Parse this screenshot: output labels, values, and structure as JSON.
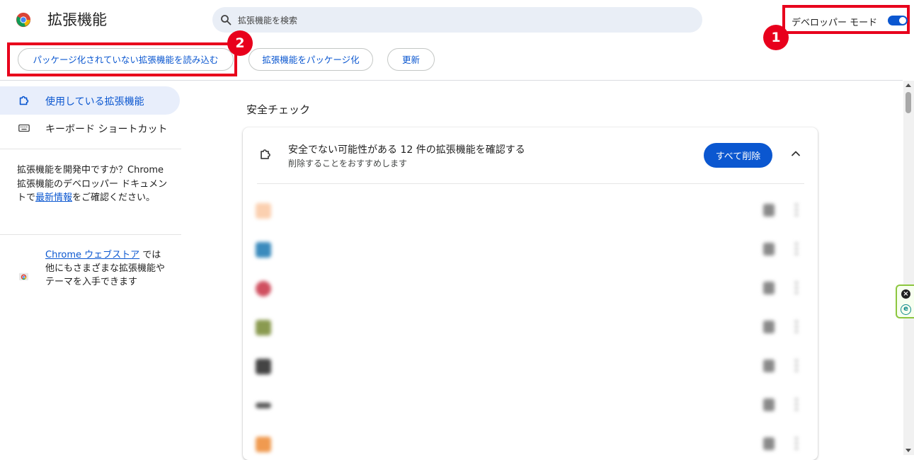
{
  "header": {
    "title": "拡張機能",
    "search_placeholder": "拡張機能を検索",
    "developer_mode_label": "デベロッパー モード",
    "developer_mode_on": true
  },
  "annotations": {
    "badge_1": "1",
    "badge_2": "2",
    "highlight_color": "#e8001c"
  },
  "toolbar": {
    "load_unpacked": "パッケージ化されていない拡張機能を読み込む",
    "pack_extension": "拡張機能をパッケージ化",
    "update": "更新"
  },
  "sidebar": {
    "items": [
      {
        "label": "使用している拡張機能",
        "icon": "extension-puzzle-icon",
        "active": true
      },
      {
        "label": "キーボード ショートカット",
        "icon": "keyboard-icon",
        "active": false
      }
    ],
    "dev_note": {
      "text_before": "拡張機能を開発中ですか？Chrome 拡張機能のデベロッパー ドキュメントで",
      "link": "最新情報",
      "text_after": "をご確認ください。"
    },
    "store_note": {
      "link": "Chrome ウェブストア",
      "text_after": " では他にもさまざまな拡張機能やテーマを入手できます"
    }
  },
  "main": {
    "section_title": "安全チェック",
    "safety_card": {
      "title": "安全でない可能性がある 12 件の拡張機能を確認する",
      "subtitle": "削除することをおすすめします",
      "remove_all_label": "すべて削除"
    }
  },
  "colors": {
    "accent": "#0b57d0",
    "active_bg": "#e8eefb",
    "search_bg": "#e9eef6"
  }
}
